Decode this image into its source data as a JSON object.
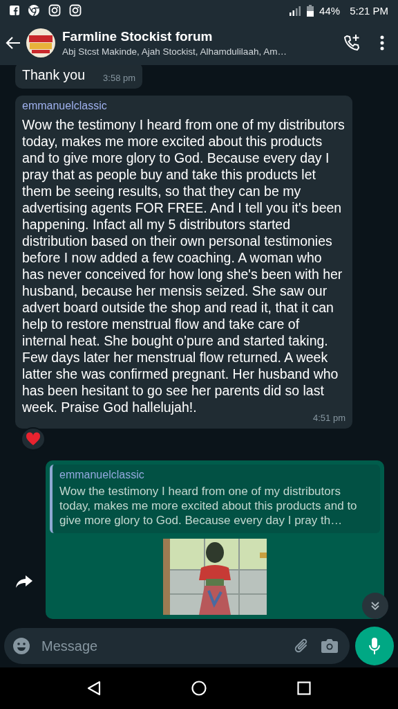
{
  "status_bar": {
    "battery": "44%",
    "time": "5:21 PM"
  },
  "header": {
    "title": "Farmline Stockist forum",
    "subtitle": "Abj Stcst Makinde, Ajah Stockist, Alhamdulilaah, Am…"
  },
  "messages": [
    {
      "kind": "incoming",
      "text": "Thank you",
      "time": "3:58 pm",
      "reacted": false
    },
    {
      "kind": "incoming",
      "sender": "emmanuelclassic",
      "text": "Wow the testimony I heard from one of my distributors today, makes me more excited about this products and to give more glory to God. Because every day I pray that as people buy and take this products let them be seeing results, so that they can be my advertising agents FOR FREE. And I tell you it's been happening. Infact all my 5 distributors started distribution based on their own personal testimonies before I now added a few coaching. A woman who has never conceived for how long she's been with her husband, because her mensis seized. She saw our advert board outside the shop and read it, that it can help to restore menstrual flow and take care of internal heat. She bought o'pure and started taking. Few days later her menstrual flow returned. A week latter she was confirmed pregnant. Her husband who has been hesitant to go see her parents did so last week. Praise God hallelujah!.",
      "time": "4:51 pm",
      "reacted": true
    },
    {
      "kind": "outgoing",
      "quote": {
        "sender": "emmanuelclassic",
        "text": "Wow the testimony I heard from one of my distributors today, makes me more excited about this products and to give more glory to God. Because every day I pray th…"
      }
    }
  ],
  "composer": {
    "placeholder": "Message"
  }
}
